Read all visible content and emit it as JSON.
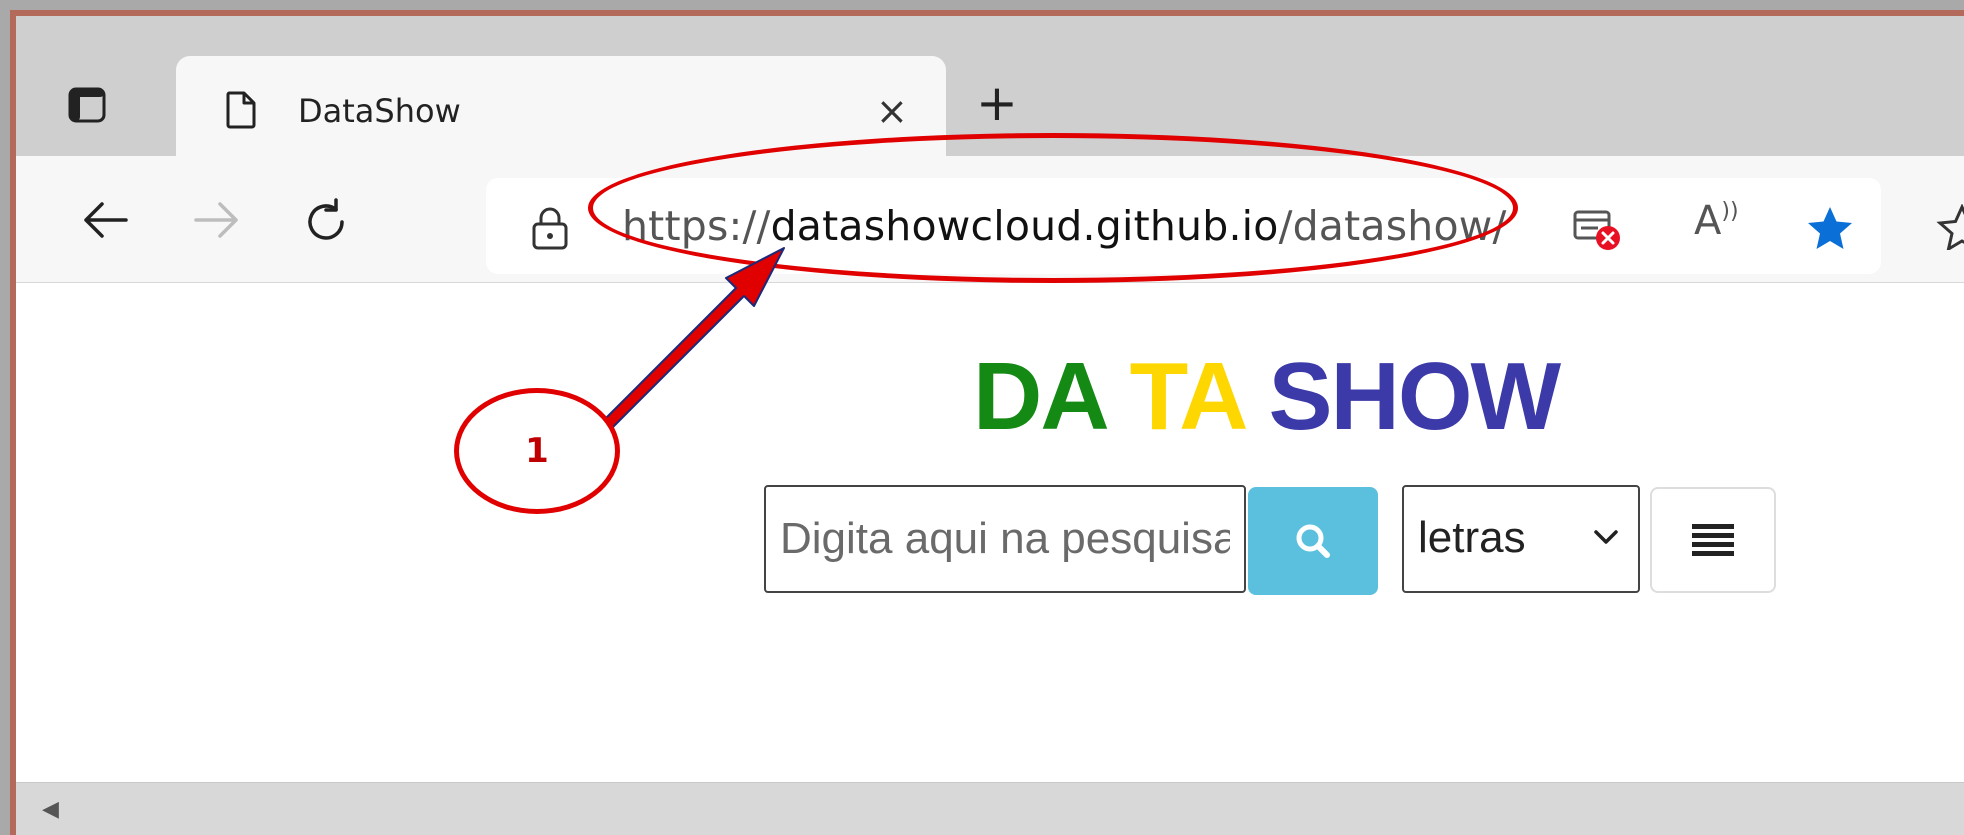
{
  "browser": {
    "tab": {
      "title": "DataShow",
      "close_label": "×"
    },
    "new_tab_label": "+",
    "address": {
      "scheme": "https://",
      "host": "datashowcloud.github.io",
      "path": "/datashow/"
    },
    "read_aloud_label": "A",
    "colors": {
      "favorite_star": "#0a6fd6",
      "blocked_badge": "#e81123"
    }
  },
  "page": {
    "logo": [
      {
        "text": "DA",
        "color": "#148a14"
      },
      {
        "text": "TA",
        "color": "#ffd700"
      },
      {
        "text": "SHOW",
        "color": "#3b3aa8"
      }
    ],
    "search": {
      "placeholder": "Digita aqui na pesquisa"
    },
    "mode_select": {
      "selected": "letras"
    },
    "search_button_color": "#5bc0de"
  },
  "annotation": {
    "label": "1",
    "color": "#e00000"
  }
}
